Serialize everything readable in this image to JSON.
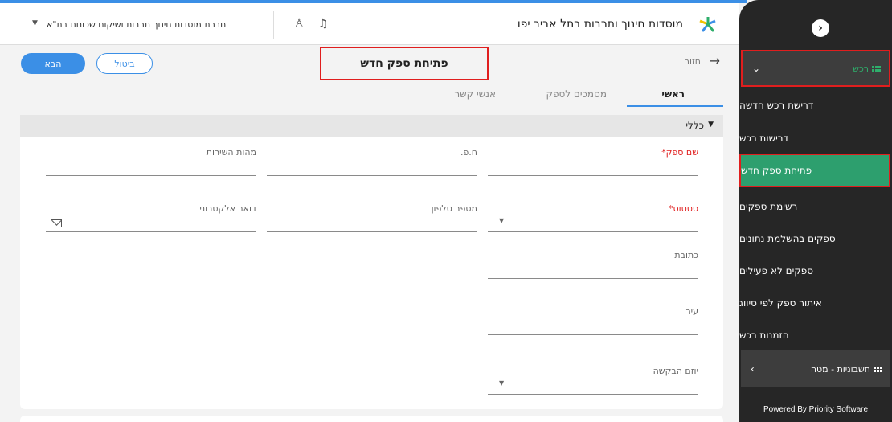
{
  "app": {
    "title": "מוסדות חינוך ותרבות בתל אביב יפו",
    "company": "חברת מוסדות חינוך תרבות ושיקום שכונות בת\"א"
  },
  "form": {
    "title": "פתיחת ספק חדש",
    "back_label": "חזור",
    "next_label": "הבא",
    "cancel_label": "ביטול"
  },
  "tabs": [
    {
      "label": "ראשי",
      "active": true
    },
    {
      "label": "מסמכים לספק",
      "active": false
    },
    {
      "label": "אנשי קשר",
      "active": false
    }
  ],
  "section": {
    "title": "כללי"
  },
  "fields": {
    "supplier_name": {
      "label": "שם ספק",
      "required": true
    },
    "company_id": {
      "label": "ח.פ.",
      "required": false
    },
    "service_nature": {
      "label": "מהות השירות",
      "required": false
    },
    "status": {
      "label": "סטטוס",
      "required": true
    },
    "phone": {
      "label": "מספר טלפון",
      "required": false
    },
    "email": {
      "label": "דואר אלקטרוני",
      "required": false
    },
    "address": {
      "label": "כתובת",
      "required": false
    },
    "city": {
      "label": "עיר",
      "required": false
    },
    "initiator": {
      "label": "יוזם הבקשה",
      "required": false
    }
  },
  "sidebar": {
    "groups": [
      {
        "label": "רכש",
        "expanded": true
      },
      {
        "label": "חשבוניות - מטה",
        "expanded": false
      }
    ],
    "items": [
      {
        "label": "דרישת רכש חדשה"
      },
      {
        "label": "דרישות רכש"
      },
      {
        "label": "פתיחת ספק חדש",
        "active": true
      },
      {
        "label": "רשימת ספקים"
      },
      {
        "label": "ספקים בהשלמת נתונים"
      },
      {
        "label": "ספקים לא פעילים"
      },
      {
        "label": "איתור ספק לפי סיווג"
      },
      {
        "label": "הזמנות רכש"
      }
    ],
    "powered_by": "Powered By Priority Software"
  },
  "colors": {
    "accent": "#3b8fe6",
    "active_item": "#2d9f6e",
    "highlight_border": "#e01e1e",
    "sidebar_bg": "#262626"
  }
}
